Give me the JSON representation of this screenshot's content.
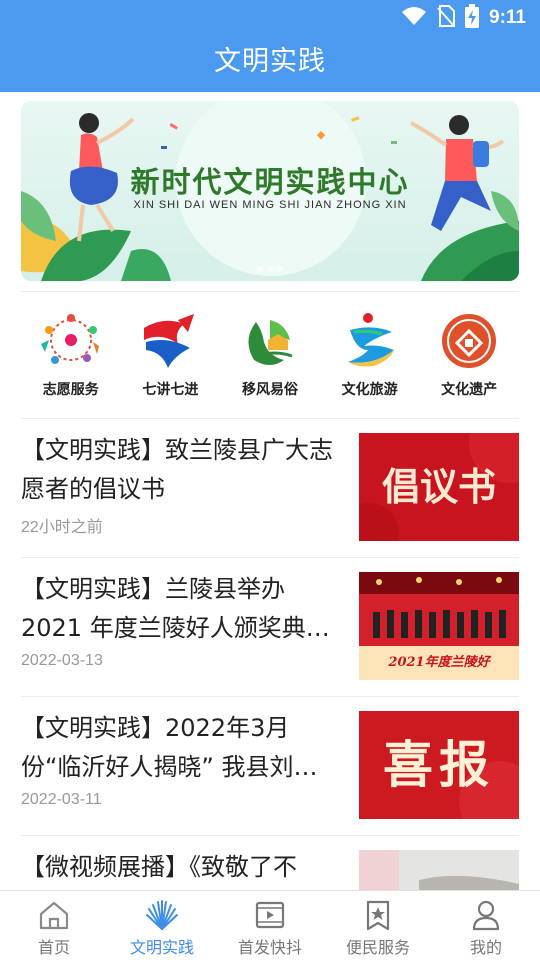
{
  "status_bar": {
    "time": "9:11"
  },
  "header": {
    "title": "文明实践"
  },
  "banner": {
    "title": "新时代文明实践中心",
    "subtitle": "XIN SHI DAI WEN MING SHI JIAN ZHONG XIN"
  },
  "categories": [
    {
      "label": "志愿服务",
      "icon": "volunteer-icon"
    },
    {
      "label": "七讲七进",
      "icon": "seven-talks-icon"
    },
    {
      "label": "移风易俗",
      "icon": "customs-icon"
    },
    {
      "label": "文化旅游",
      "icon": "culture-tourism-icon"
    },
    {
      "label": "文化遗产",
      "icon": "cultural-heritage-icon"
    }
  ],
  "news": [
    {
      "title": "【文明实践】致兰陵县广大志愿者的倡议书",
      "date": "22小时之前",
      "thumb_text": "倡议书"
    },
    {
      "title": "【文明实践】兰陵县举办 2021 年度兰陵好人颁奖典…",
      "date": "2022-03-13",
      "thumb_text": "2021年度兰陵好"
    },
    {
      "title": "【文明实践】2022年3月份“临沂好人揭晓” 我县刘…",
      "date": "2022-03-11",
      "thumb_text": "喜报"
    },
    {
      "title": "【微视频展播】《致敬了不",
      "date": "",
      "thumb_text": ""
    }
  ],
  "tabs": [
    {
      "label": "首页",
      "icon": "home-icon",
      "active": false
    },
    {
      "label": "文明实践",
      "icon": "civilization-icon",
      "active": true
    },
    {
      "label": "首发快抖",
      "icon": "video-icon",
      "active": false
    },
    {
      "label": "便民服务",
      "icon": "star-bookmark-icon",
      "active": false
    },
    {
      "label": "我的",
      "icon": "profile-icon",
      "active": false
    }
  ],
  "colors": {
    "header_blue": "#4b9af0",
    "active_tab": "#3e8de8",
    "thumb_red": "#c8141e"
  }
}
